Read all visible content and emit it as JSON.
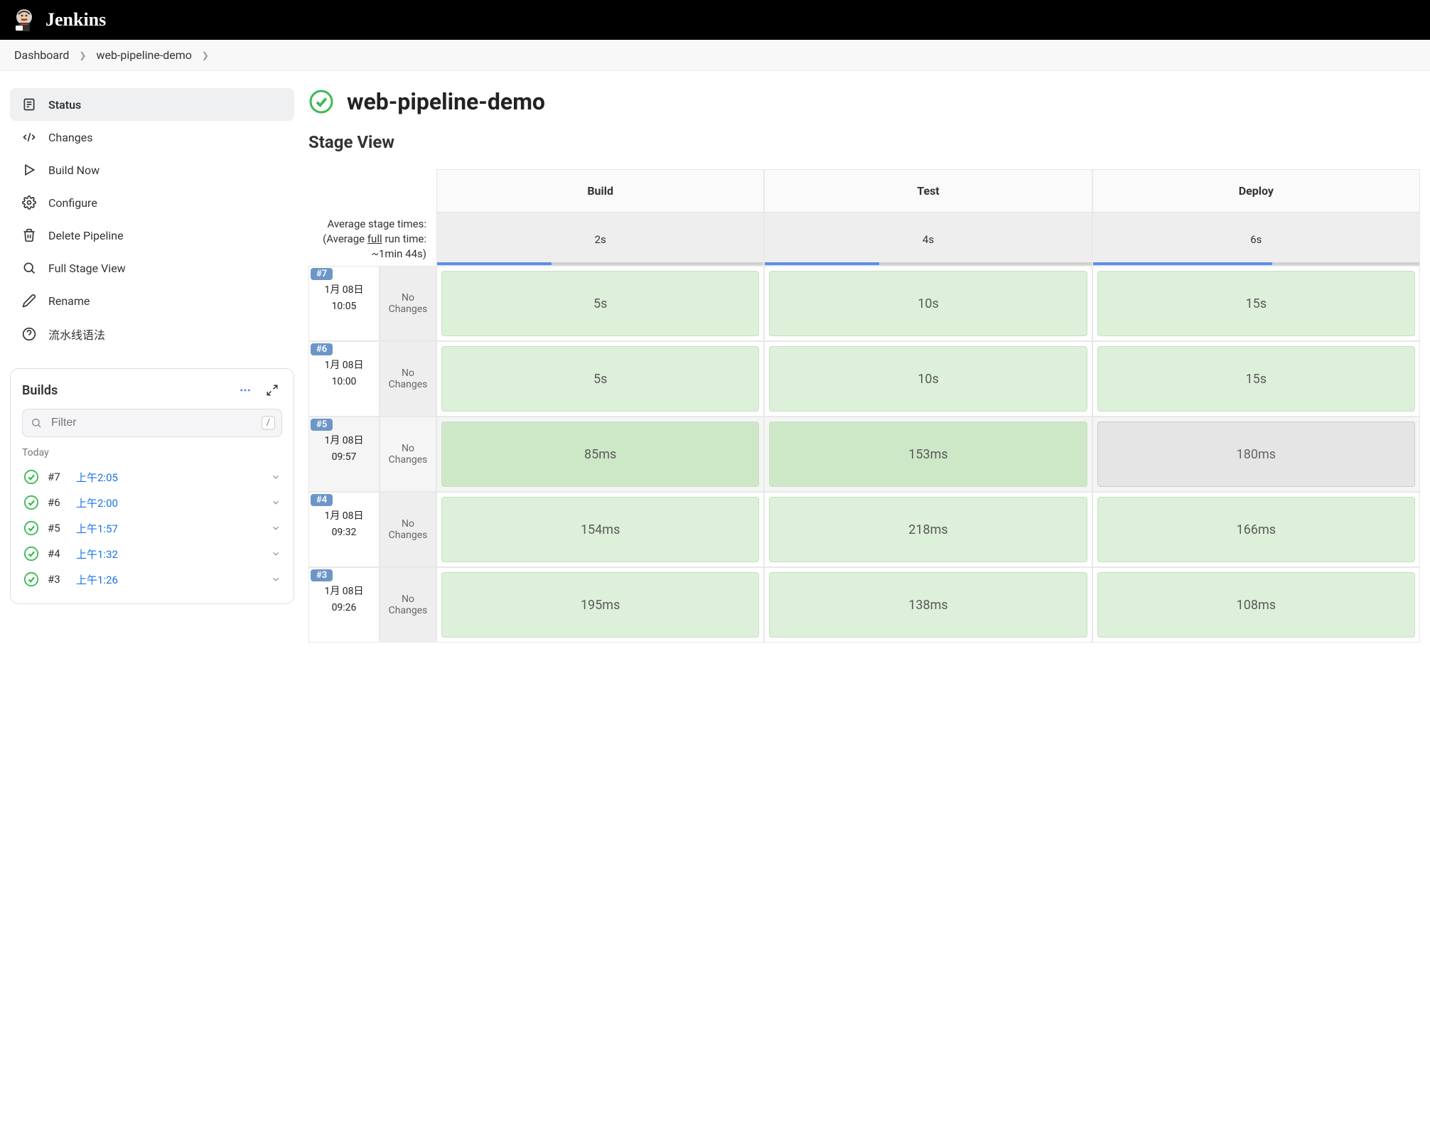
{
  "header": {
    "product": "Jenkins"
  },
  "breadcrumb": [
    {
      "label": "Dashboard"
    },
    {
      "label": "web-pipeline-demo"
    }
  ],
  "sidebar": {
    "items": [
      {
        "label": "Status",
        "active": true,
        "icon": "status"
      },
      {
        "label": "Changes",
        "icon": "changes"
      },
      {
        "label": "Build Now",
        "icon": "play"
      },
      {
        "label": "Configure",
        "icon": "gear"
      },
      {
        "label": "Delete Pipeline",
        "icon": "trash"
      },
      {
        "label": "Full Stage View",
        "icon": "search"
      },
      {
        "label": "Rename",
        "icon": "pencil"
      },
      {
        "label": "流水线语法",
        "icon": "help"
      }
    ]
  },
  "builds": {
    "title": "Builds",
    "filter_placeholder": "Filter",
    "filter_key": "/",
    "today_label": "Today",
    "items": [
      {
        "num": "#7",
        "time": "上午2:05"
      },
      {
        "num": "#6",
        "time": "上午2:00"
      },
      {
        "num": "#5",
        "time": "上午1:57"
      },
      {
        "num": "#4",
        "time": "上午1:32"
      },
      {
        "num": "#3",
        "time": "上午1:26"
      }
    ]
  },
  "page": {
    "title": "web-pipeline-demo",
    "section": "Stage View"
  },
  "stage_view": {
    "columns": [
      "Build",
      "Test",
      "Deploy"
    ],
    "avg_label_1": "Average stage times:",
    "avg_label_2a": "(Average ",
    "avg_label_2b": "full",
    "avg_label_2c": " run time: ~1min 44s)",
    "avg_values": [
      "2s",
      "4s",
      "6s"
    ],
    "avg_bar_pct": [
      35,
      35,
      55
    ],
    "no_changes": "No Changes",
    "runs": [
      {
        "badge": "#7",
        "date": "1月 08日",
        "time": "10:05",
        "cells": [
          "5s",
          "10s",
          "15s"
        ]
      },
      {
        "badge": "#6",
        "date": "1月 08日",
        "time": "10:00",
        "cells": [
          "5s",
          "10s",
          "15s"
        ]
      },
      {
        "badge": "#5",
        "date": "1月 08日",
        "time": "09:57",
        "cells": [
          "85ms",
          "153ms",
          "180ms"
        ],
        "hover": true
      },
      {
        "badge": "#4",
        "date": "1月 08日",
        "time": "09:32",
        "cells": [
          "154ms",
          "218ms",
          "166ms"
        ]
      },
      {
        "badge": "#3",
        "date": "1月 08日",
        "time": "09:26",
        "cells": [
          "195ms",
          "138ms",
          "108ms"
        ]
      }
    ]
  }
}
